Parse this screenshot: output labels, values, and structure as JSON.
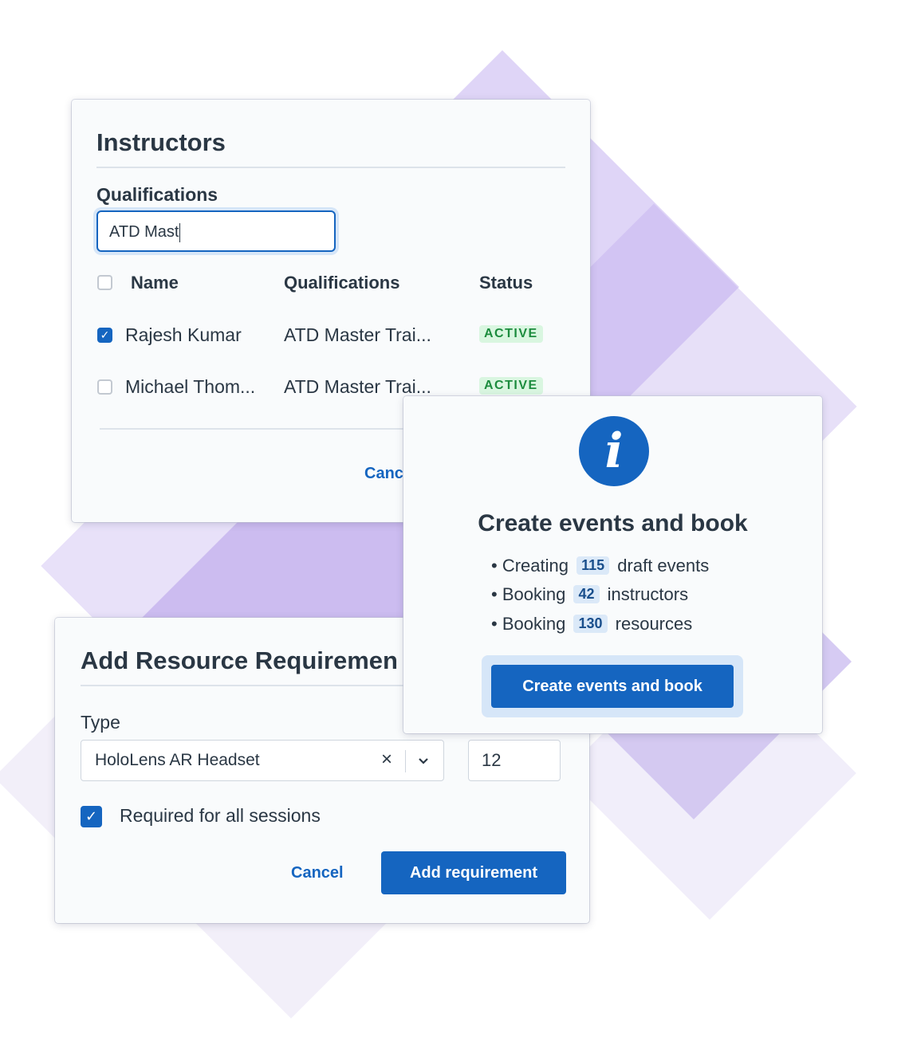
{
  "background": {
    "accent": "#c9b8ef"
  },
  "instructors_card": {
    "title": "Instructors",
    "filter_label": "Qualifications",
    "filter_value": "ATD Mast",
    "columns": [
      "Name",
      "Qualifications",
      "Status"
    ],
    "rows": [
      {
        "name": "Rajesh Kumar",
        "qualification": "ATD Master Trai...",
        "status": "ACTIVE",
        "checked": true
      },
      {
        "name": "Michael Thom...",
        "qualification": "ATD Master Trai...",
        "status": "ACTIVE",
        "checked": false
      }
    ],
    "cancel_label": "Canc"
  },
  "resource_card": {
    "title": "Add Resource Requiremen",
    "type_label": "Type",
    "type_value": "HoloLens AR Headset",
    "quantity_value": "12",
    "required_all_label": "Required for all sessions",
    "required_all_checked": true,
    "cancel_label": "Cancel",
    "submit_label": "Add requirement"
  },
  "modal": {
    "icon": "info-icon",
    "title": "Create events and book",
    "items": [
      {
        "prefix": "Creating",
        "count": "115",
        "suffix": "draft events"
      },
      {
        "prefix": "Booking",
        "count": "42",
        "suffix": "instructors"
      },
      {
        "prefix": "Booking",
        "count": "130",
        "suffix": "resources"
      }
    ],
    "button_label": "Create events and book"
  },
  "colors": {
    "primary": "#1565c0",
    "success": "#1c8c3e",
    "badge_bg": "#d9f6e0"
  }
}
